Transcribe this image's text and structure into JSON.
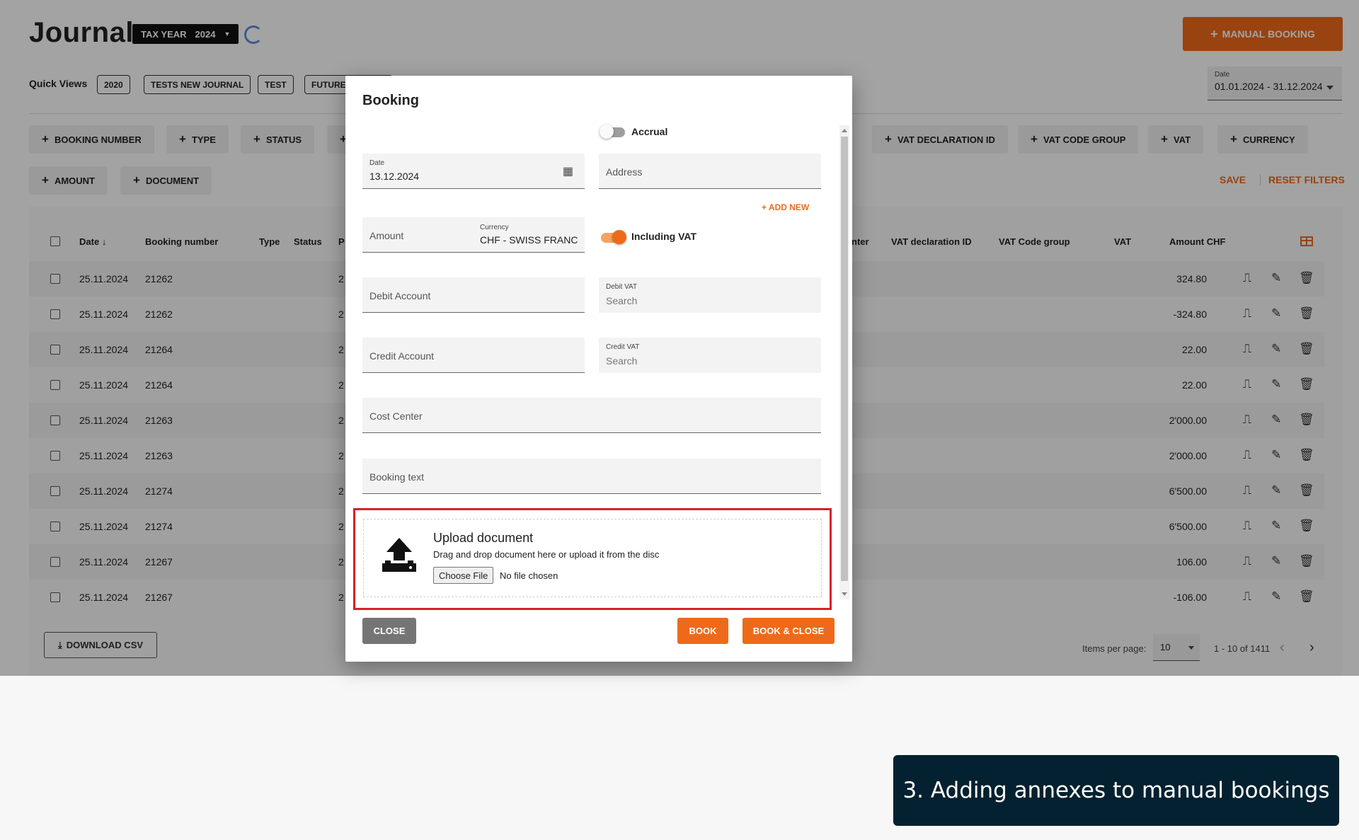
{
  "header": {
    "title": "Journal",
    "tax_year_label": "TAX YEAR",
    "tax_year_value": "2024",
    "manual_booking_label": "MANUAL BOOKING"
  },
  "quick_views": {
    "label": "Quick Views",
    "items": [
      "2020",
      "TESTS NEW JOURNAL",
      "TEST",
      "FUTURE"
    ]
  },
  "date_filter": {
    "label": "Date",
    "value": "01.01.2024 - 31.12.2024"
  },
  "filter_chips": {
    "row1": [
      "BOOKING NUMBER",
      "TYPE",
      "STATUS",
      "",
      "VAT DECLARATION ID",
      "VAT CODE GROUP",
      "VAT",
      "CURRENCY"
    ],
    "row2": [
      "AMOUNT",
      "DOCUMENT"
    ]
  },
  "filter_actions": {
    "save": "SAVE",
    "reset": "RESET FILTERS"
  },
  "table": {
    "headers": {
      "date": "Date",
      "booking_number": "Booking number",
      "type": "Type",
      "status": "Status",
      "p": "P",
      "cost_center": "nter",
      "vat_declaration_id": "VAT declaration ID",
      "vat_code_group": "VAT Code group",
      "vat": "VAT",
      "amount_chf": "Amount CHF"
    },
    "rows": [
      {
        "date": "25.11.2024",
        "booking_number": "21262",
        "p": "2",
        "amount": "324.80"
      },
      {
        "date": "25.11.2024",
        "booking_number": "21262",
        "p": "2",
        "amount": "-324.80"
      },
      {
        "date": "25.11.2024",
        "booking_number": "21264",
        "p": "2",
        "amount": "22.00"
      },
      {
        "date": "25.11.2024",
        "booking_number": "21264",
        "p": "2",
        "amount": "22.00"
      },
      {
        "date": "25.11.2024",
        "booking_number": "21263",
        "p": "2",
        "amount": "2'000.00"
      },
      {
        "date": "25.11.2024",
        "booking_number": "21263",
        "p": "2",
        "amount": "2'000.00"
      },
      {
        "date": "25.11.2024",
        "booking_number": "21274",
        "p": "2",
        "amount": "6'500.00"
      },
      {
        "date": "25.11.2024",
        "booking_number": "21274",
        "p": "2",
        "amount": "6'500.00"
      },
      {
        "date": "25.11.2024",
        "booking_number": "21267",
        "p": "2",
        "amount": "106.00"
      },
      {
        "date": "25.11.2024",
        "booking_number": "21267",
        "p": "2",
        "amount": "-106.00"
      }
    ]
  },
  "footer": {
    "download_csv": "DOWNLOAD CSV",
    "items_per_page_label": "Items per page:",
    "items_per_page_value": "10",
    "range": "1 - 10 of 1411"
  },
  "modal": {
    "title": "Booking",
    "accrual_label": "Accrual",
    "date_label": "Date",
    "date_value": "13.12.2024",
    "address_placeholder": "Address",
    "add_new": "ADD NEW",
    "amount_placeholder": "Amount",
    "currency_label": "Currency",
    "currency_value": "CHF - SWISS FRANC",
    "including_vat_label": "Including VAT",
    "debit_account_placeholder": "Debit Account",
    "debit_vat_label": "Debit VAT",
    "debit_vat_search": "Search",
    "credit_account_placeholder": "Credit Account",
    "credit_vat_label": "Credit VAT",
    "credit_vat_search": "Search",
    "cost_center_placeholder": "Cost Center",
    "booking_text_placeholder": "Booking text",
    "upload_title": "Upload document",
    "upload_desc": "Drag and drop document here or upload it from the disc",
    "choose_file": "Choose File",
    "no_file": "No file chosen",
    "close": "CLOSE",
    "book": "BOOK",
    "book_close": "BOOK & CLOSE"
  },
  "caption": "3. Adding annexes to manual bookings",
  "colors": {
    "accent": "#ee6a1a",
    "highlight": "#d8202a",
    "caption_bg": "#032130"
  }
}
